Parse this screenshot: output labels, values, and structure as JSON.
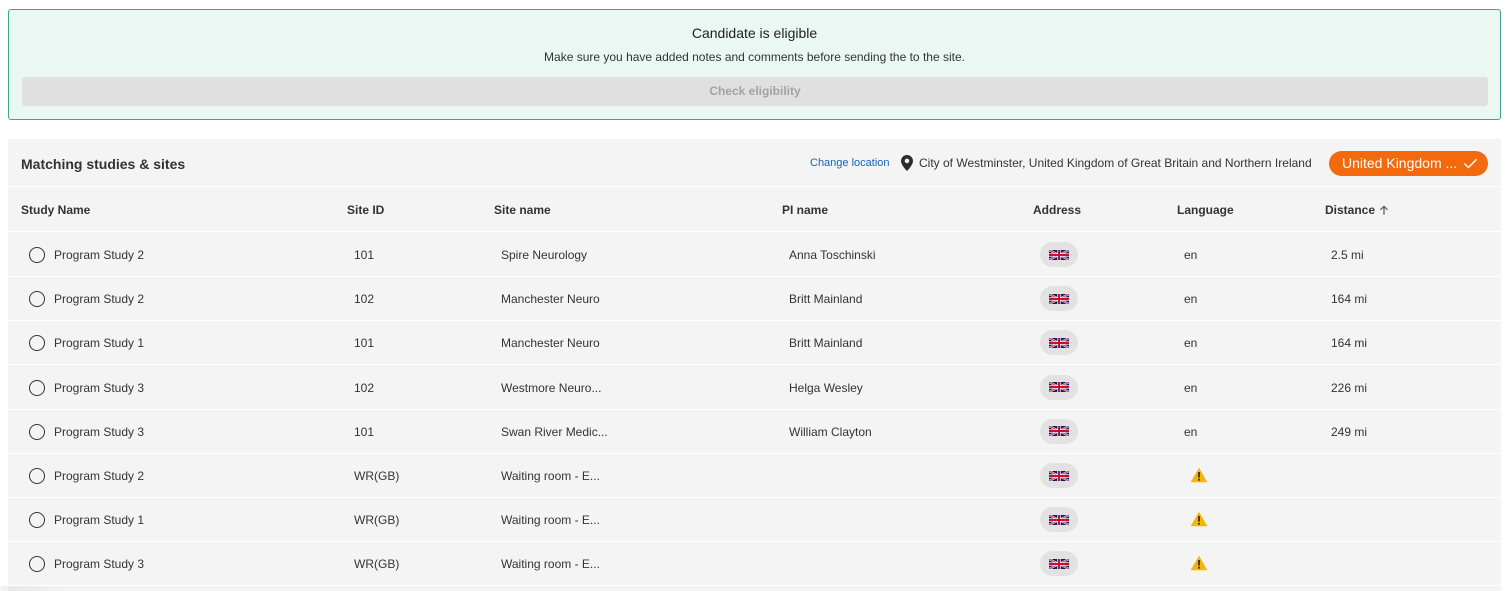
{
  "banner": {
    "title": "Candidate is eligible",
    "subtitle": "Make sure you have added notes and comments before sending the to the site.",
    "button_label": "Check eligibility"
  },
  "panel": {
    "title": "Matching studies & sites",
    "change_location": "Change location",
    "location_icon": "map-pin-icon",
    "location": "City of Westminster, United Kingdom of Great Britain and Northern Ireland",
    "country_button": "United Kingdom ...",
    "country_button_icon": "checkmark-icon",
    "accent_color": "#f26a0d"
  },
  "table": {
    "headers": {
      "study_name": "Study Name",
      "site_id": "Site ID",
      "site_name": "Site name",
      "pi_name": "PI name",
      "address": "Address",
      "language": "Language",
      "distance": "Distance"
    },
    "sort_icon": "arrow-up-icon",
    "rows": [
      {
        "study": "Program Study 2",
        "site_id": "101",
        "site_name": "Spire Neurology",
        "pi": "Anna Toschinski",
        "address_icon": "uk-flag-icon",
        "language": "en",
        "distance": "2.5 mi"
      },
      {
        "study": "Program Study 2",
        "site_id": "102",
        "site_name": "Manchester Neuro",
        "pi": "Britt Mainland",
        "address_icon": "uk-flag-icon",
        "language": "en",
        "distance": "164 mi"
      },
      {
        "study": "Program Study 1",
        "site_id": "101",
        "site_name": "Manchester Neuro",
        "pi": "Britt Mainland",
        "address_icon": "uk-flag-icon",
        "language": "en",
        "distance": "164 mi"
      },
      {
        "study": "Program Study 3",
        "site_id": "102",
        "site_name": "Westmore Neuro...",
        "pi": "Helga Wesley",
        "address_icon": "uk-flag-icon",
        "language": "en",
        "distance": "226 mi"
      },
      {
        "study": "Program Study 3",
        "site_id": "101",
        "site_name": "Swan River Medic...",
        "pi": "William Clayton",
        "address_icon": "uk-flag-icon",
        "language": "en",
        "distance": "249 mi"
      },
      {
        "study": "Program Study 2",
        "site_id": "WR(GB)",
        "site_name": "Waiting room - E...",
        "pi": "",
        "address_icon": "uk-flag-icon",
        "language_icon": "warning-icon",
        "distance": ""
      },
      {
        "study": "Program Study 1",
        "site_id": "WR(GB)",
        "site_name": "Waiting room - E...",
        "pi": "",
        "address_icon": "uk-flag-icon",
        "language_icon": "warning-icon",
        "distance": ""
      },
      {
        "study": "Program Study 3",
        "site_id": "WR(GB)",
        "site_name": "Waiting room - E...",
        "pi": "",
        "address_icon": "uk-flag-icon",
        "language_icon": "warning-icon",
        "distance": ""
      }
    ]
  }
}
